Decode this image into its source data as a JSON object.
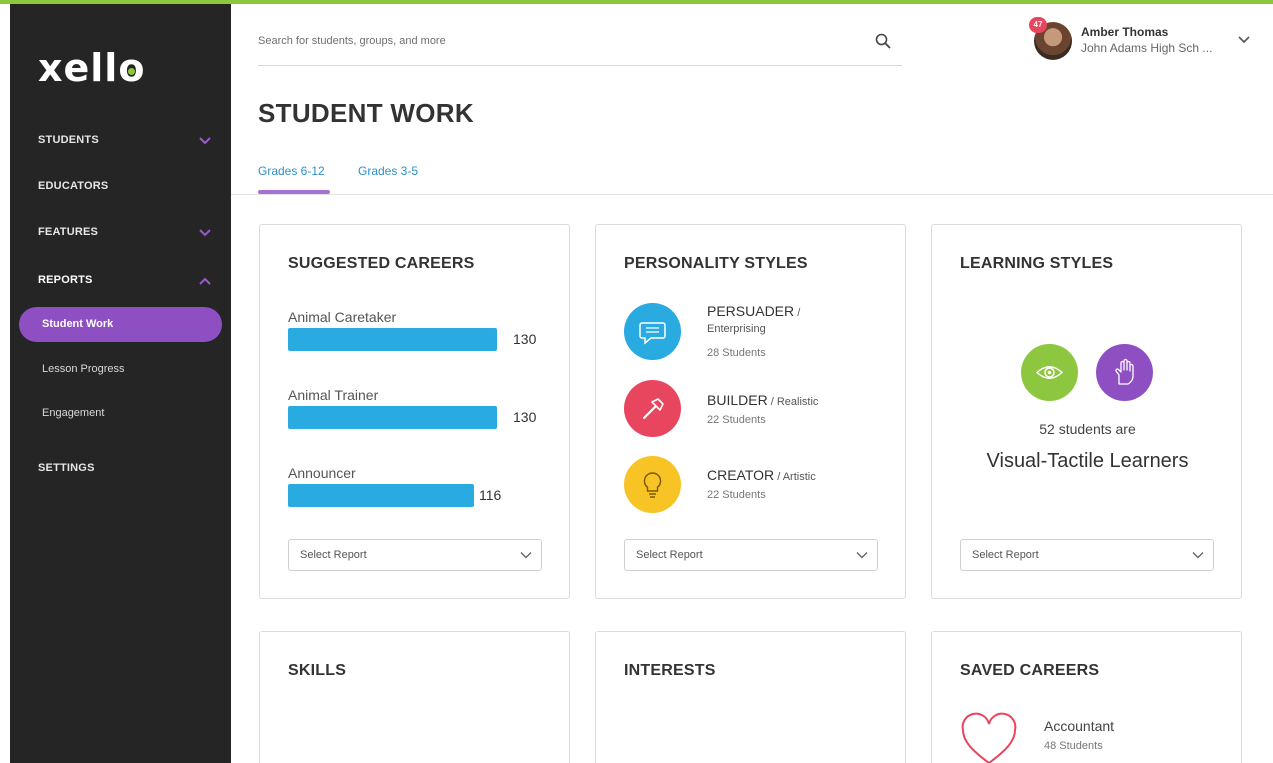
{
  "app": {
    "logo": "xello"
  },
  "colors": {
    "accent_green": "#8dc63f",
    "accent_purple": "#8e4fc2",
    "bar_blue": "#29aae1",
    "link_blue": "#2c8fcc",
    "sidebar_bg": "#252526",
    "persuader": "#29aae1",
    "builder": "#e8455e",
    "creator": "#f7c325",
    "visual": "#8dc63f",
    "tactile": "#8e4fc2",
    "heart": "#e8455e"
  },
  "sidebar": {
    "items": [
      {
        "label": "STUDENTS",
        "icon": "chevron-down-icon"
      },
      {
        "label": "EDUCATORS"
      },
      {
        "label": "FEATURES",
        "icon": "chevron-down-icon"
      },
      {
        "label": "REPORTS",
        "icon": "chevron-up-icon"
      },
      {
        "label": "SETTINGS"
      }
    ],
    "reports_children": [
      {
        "label": "Student Work",
        "active": true
      },
      {
        "label": "Lesson Progress"
      },
      {
        "label": "Engagement"
      }
    ]
  },
  "search": {
    "placeholder": "Search for students, groups, and more",
    "icon": "search-icon"
  },
  "user": {
    "name": "Amber Thomas",
    "school": "John Adams High Sch ...",
    "notifications": "47"
  },
  "page": {
    "title": "STUDENT WORK"
  },
  "tabs": [
    {
      "label": "Grades 6-12",
      "active": true
    },
    {
      "label": "Grades 3-5"
    }
  ],
  "cards": {
    "suggested_careers": {
      "title": "SUGGESTED CAREERS",
      "items": [
        {
          "label": "Animal Caretaker",
          "value": 130
        },
        {
          "label": "Animal Trainer",
          "value": 130
        },
        {
          "label": "Announcer",
          "value": 116
        }
      ],
      "select_label": "Select Report"
    },
    "personality_styles": {
      "title": "PERSONALITY STYLES",
      "items": [
        {
          "name": "PERSUADER",
          "sub": " / ",
          "sub2": "Enterprising",
          "count": "28 Students",
          "icon": "speech-bubble-icon"
        },
        {
          "name": "BUILDER",
          "sub": " / Realistic",
          "count": "22 Students",
          "icon": "hammer-icon"
        },
        {
          "name": "CREATOR",
          "sub": " / Artistic",
          "count": "22 Students",
          "icon": "lightbulb-icon"
        }
      ],
      "select_label": "Select Report"
    },
    "learning_styles": {
      "title": "LEARNING STYLES",
      "count_text": "52 students are",
      "type_text": "Visual-Tactile Learners",
      "icons": [
        "eye-icon",
        "hand-icon"
      ],
      "select_label": "Select Report"
    },
    "skills": {
      "title": "SKILLS"
    },
    "interests": {
      "title": "INTERESTS"
    },
    "saved_careers": {
      "title": "SAVED CAREERS",
      "item_name": "Accountant",
      "item_count": "48 Students",
      "icon": "heart-icon"
    }
  }
}
